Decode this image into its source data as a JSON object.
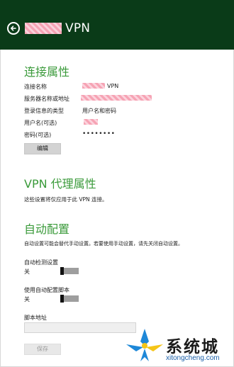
{
  "header": {
    "title": "VPN"
  },
  "connection": {
    "section_title": "连接属性",
    "rows": [
      {
        "label": "连接名称",
        "value": "VPN"
      },
      {
        "label": "服务器名称或地址",
        "value": ""
      },
      {
        "label": "登录信息的类型",
        "value": "用户名和密码"
      },
      {
        "label": "用户名(可选)",
        "value": ""
      },
      {
        "label": "密码(可选)",
        "value": "••••••••"
      }
    ],
    "edit_label": "编辑"
  },
  "proxy": {
    "section_title": "VPN 代理属性",
    "description": "这些设置将仅应用于此 VPN 连接。"
  },
  "auto": {
    "section_title": "自动配置",
    "description": "自动设置可能会替代手动设置。若要使用手动设置，请先关闭自动设置。",
    "auto_detect": {
      "label": "自动检测设置",
      "state": "关"
    },
    "use_script": {
      "label": "使用自动配置脚本",
      "state": "关"
    },
    "script_address_label": "脚本地址",
    "script_address_value": "",
    "save_label": "保存"
  },
  "watermark": {
    "brand": "系统城",
    "site": "xitongcheng.com"
  },
  "colors": {
    "header_bg": "#0a3b18",
    "accent_green": "#3a9a3a"
  }
}
